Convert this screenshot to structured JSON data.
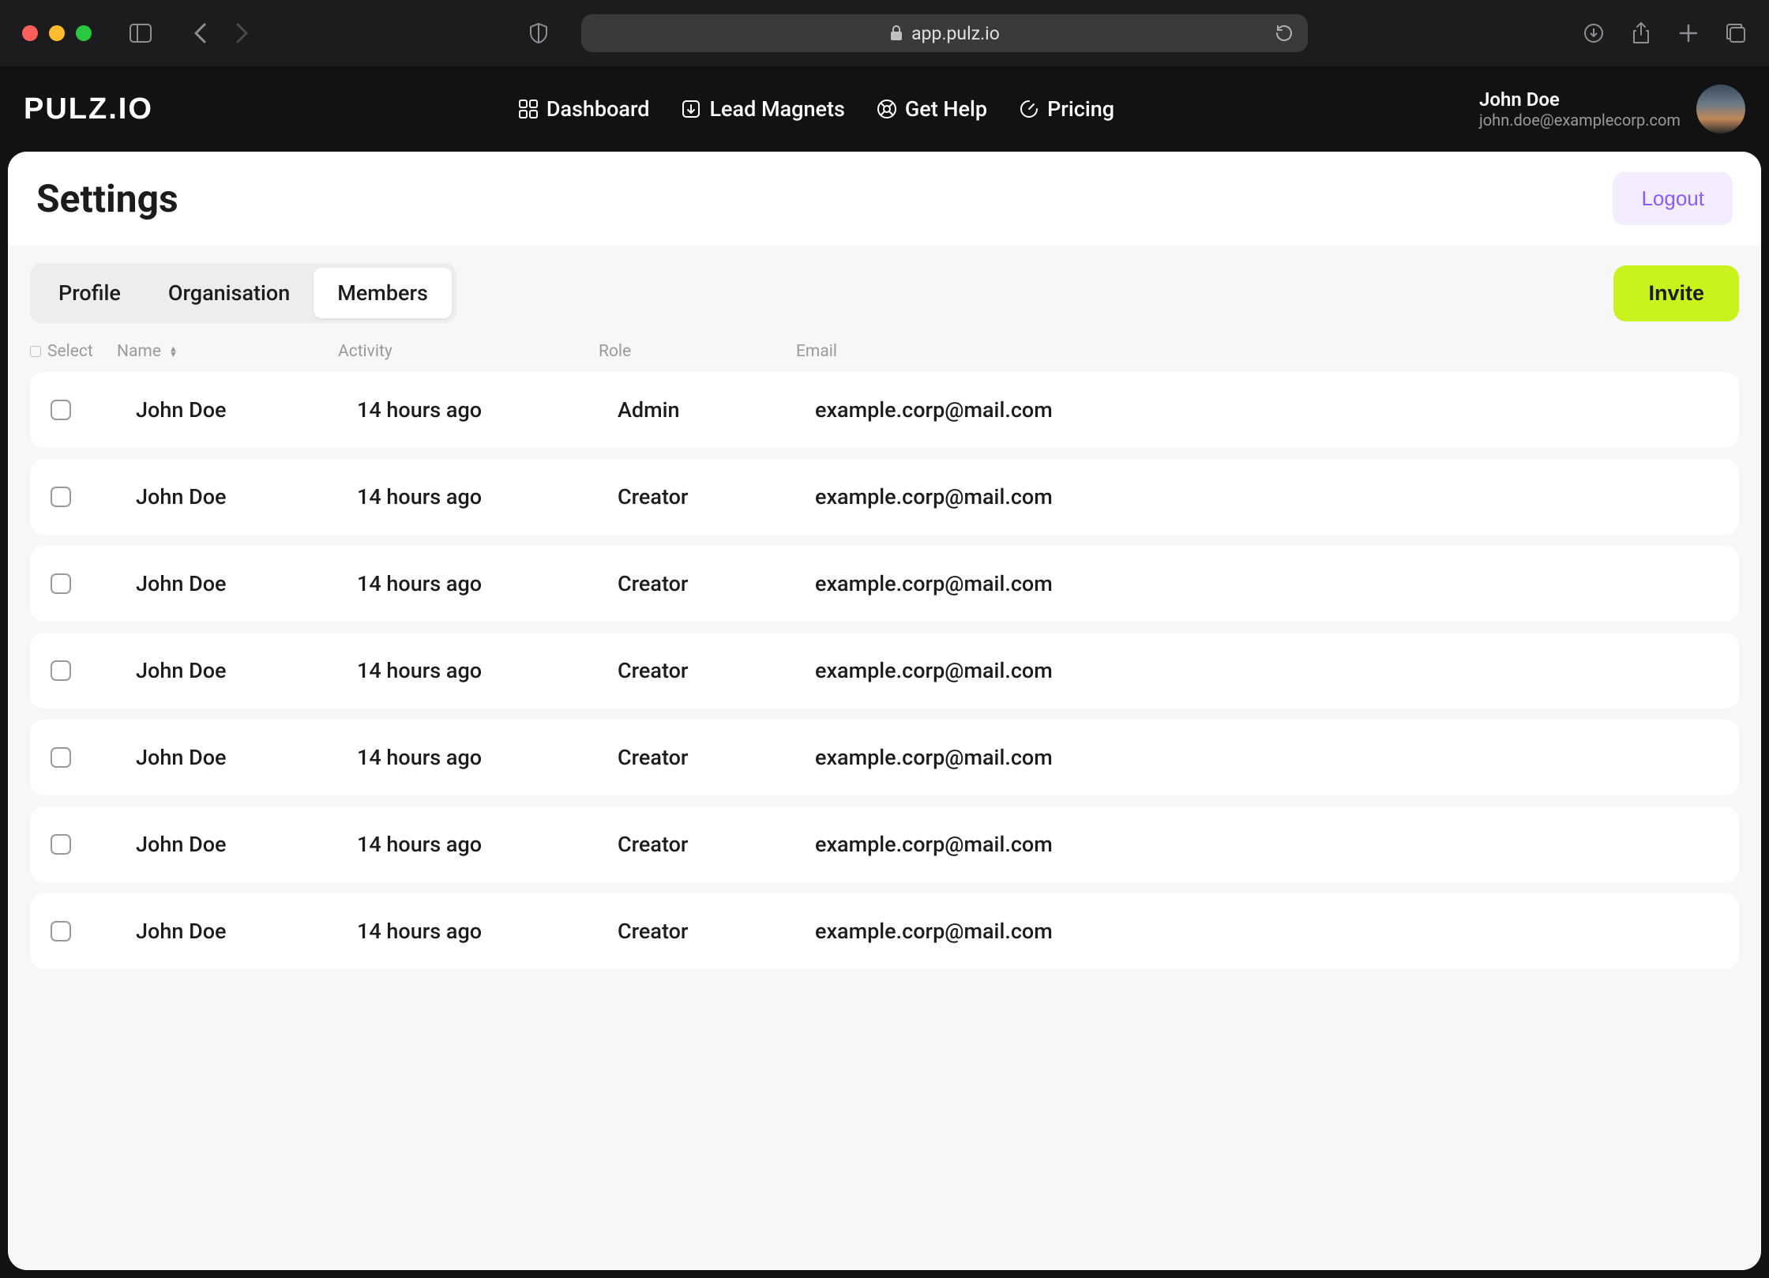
{
  "browser": {
    "url": "app.pulz.io"
  },
  "brand": "PULZ.IO",
  "nav": {
    "dashboard": "Dashboard",
    "lead_magnets": "Lead Magnets",
    "get_help": "Get Help",
    "pricing": "Pricing"
  },
  "user": {
    "name": "John Doe",
    "email": "john.doe@examplecorp.com"
  },
  "page": {
    "title": "Settings",
    "logout": "Logout",
    "invite": "Invite"
  },
  "tabs": {
    "profile": "Profile",
    "organisation": "Organisation",
    "members": "Members"
  },
  "table": {
    "headers": {
      "select": "Select",
      "name": "Name",
      "activity": "Activity",
      "role": "Role",
      "email": "Email"
    },
    "rows": [
      {
        "name": "John Doe",
        "activity": "14 hours ago",
        "role": "Admin",
        "email": "example.corp@mail.com"
      },
      {
        "name": "John Doe",
        "activity": "14 hours ago",
        "role": "Creator",
        "email": "example.corp@mail.com"
      },
      {
        "name": "John Doe",
        "activity": "14 hours ago",
        "role": "Creator",
        "email": "example.corp@mail.com"
      },
      {
        "name": "John Doe",
        "activity": "14 hours ago",
        "role": "Creator",
        "email": "example.corp@mail.com"
      },
      {
        "name": "John Doe",
        "activity": "14 hours ago",
        "role": "Creator",
        "email": "example.corp@mail.com"
      },
      {
        "name": "John Doe",
        "activity": "14 hours ago",
        "role": "Creator",
        "email": "example.corp@mail.com"
      },
      {
        "name": "John Doe",
        "activity": "14 hours ago",
        "role": "Creator",
        "email": "example.corp@mail.com"
      }
    ]
  }
}
